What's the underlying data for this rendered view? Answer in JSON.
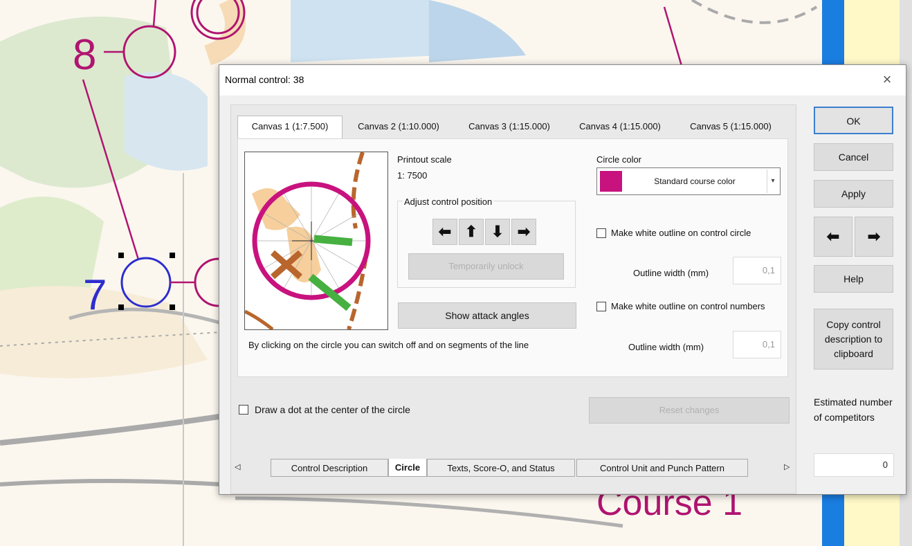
{
  "background_map": {
    "control_numbers": [
      "8",
      "7"
    ],
    "course_label": "Course 1"
  },
  "dialog": {
    "title": "Normal control: 38",
    "close_glyph": "×",
    "canvas_tabs": [
      {
        "label": "Canvas 1  (1:7.500)",
        "active": true
      },
      {
        "label": "Canvas 2  (1:10.000)",
        "active": false
      },
      {
        "label": "Canvas 3  (1:15.000)",
        "active": false
      },
      {
        "label": "Canvas 4  (1:15.000)",
        "active": false
      },
      {
        "label": "Canvas 5  (1:15.000)",
        "active": false
      }
    ],
    "printout_scale_label": "Printout scale",
    "printout_scale_value": "1: 7500",
    "adjust_position_label": "Adjust control position",
    "arrows": {
      "left": "⬅",
      "up": "⬆",
      "down": "⬇",
      "right": "➡"
    },
    "temporarily_unlock": "Temporarily unlock",
    "show_attack_angles": "Show attack angles",
    "hint_text": "By clicking on the circle you can switch off and on segments of the line",
    "circle_color_label": "Circle color",
    "circle_color_value": "Standard course color",
    "circle_color_swatch": "#c8127e",
    "white_outline_circle": "Make white outline on control circle",
    "outline_width_label_1": "Outline width (mm)",
    "outline_width_value_1": "0,1",
    "white_outline_numbers": "Make white outline on control numbers",
    "outline_width_label_2": "Outline width (mm)",
    "outline_width_value_2": "0,1",
    "draw_dot": "Draw a dot at the center of the circle",
    "reset_changes": "Reset changes",
    "bottom_tabs": [
      {
        "label": "Control Description",
        "active": false
      },
      {
        "label": "Circle",
        "active": true
      },
      {
        "label": "Texts, Score-O, and Status",
        "active": false
      },
      {
        "label": "Control Unit and Punch Pattern",
        "active": false
      }
    ],
    "scroll_left": "◁",
    "scroll_right": "▷",
    "buttons": {
      "ok": "OK",
      "cancel": "Cancel",
      "apply": "Apply",
      "prev": "⬅",
      "next": "➡",
      "help": "Help",
      "copy_description": "Copy control description to clipboard"
    },
    "estimated_label": "Estimated number of competitors",
    "estimated_value": "0"
  }
}
